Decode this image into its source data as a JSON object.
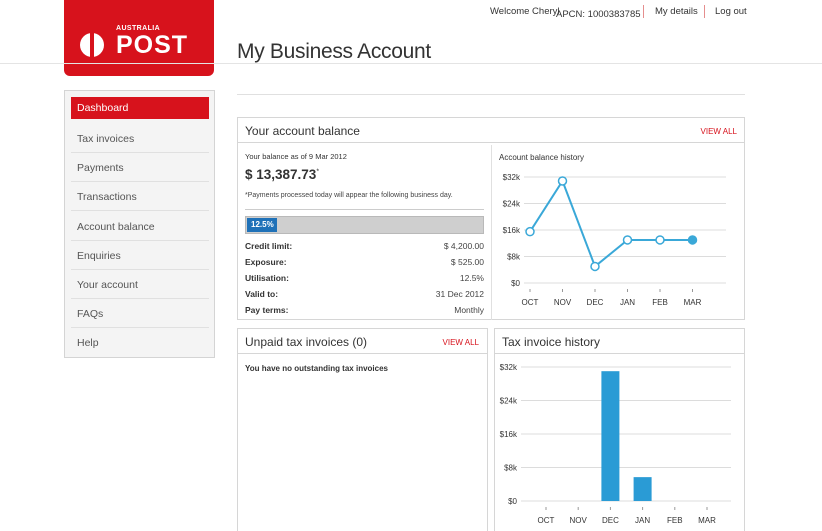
{
  "brand": {
    "country": "AUSTRALIA",
    "name": "POST",
    "color": "#d7121c"
  },
  "page_title": "My Business Account",
  "topnav": {
    "welcome": "Welcome Cheryl",
    "apcn": "APCN: 1000383785",
    "my_details": "My details",
    "log_out": "Log out"
  },
  "sidebar": {
    "items": [
      {
        "label": "Dashboard",
        "active": true
      },
      {
        "label": "Tax invoices"
      },
      {
        "label": "Payments"
      },
      {
        "label": "Transactions"
      },
      {
        "label": "Account balance"
      },
      {
        "label": "Enquiries"
      },
      {
        "label": "Your account"
      },
      {
        "label": "FAQs"
      },
      {
        "label": "Help"
      }
    ]
  },
  "balance": {
    "title": "Your account balance",
    "view_all": "VIEW ALL",
    "as_of": "Your balance as of 9 Mar 2012",
    "amount": "$ 13,387.73",
    "amount_mark": "*",
    "note": "*Payments processed today will appear the following business day.",
    "progress_label": "12.5%",
    "progress_value": 0.125,
    "rows": [
      {
        "label": "Credit limit:",
        "value": "$ 4,200.00"
      },
      {
        "label": "Exposure:",
        "value": "$ 525.00"
      },
      {
        "label": "Utilisation:",
        "value": "12.5%"
      },
      {
        "label": "Valid to:",
        "value": "31 Dec 2012"
      },
      {
        "label": "Pay terms:",
        "value": "Monthly"
      }
    ],
    "history_title": "Account balance history"
  },
  "unpaid": {
    "title": "Unpaid tax invoices (0)",
    "view_all": "VIEW ALL",
    "message": "You have no outstanding tax invoices"
  },
  "tax_history": {
    "title": "Tax invoice history"
  },
  "chart_data": [
    {
      "type": "line",
      "title": "Account balance history",
      "categories": [
        "OCT",
        "NOV",
        "DEC",
        "JAN",
        "FEB",
        "MAR"
      ],
      "values": [
        15500,
        30800,
        5000,
        13000,
        13000,
        13000
      ],
      "y_ticks": [
        "$0",
        "$8k",
        "$16k",
        "$24k",
        "$32k"
      ],
      "ylim": [
        0,
        32000
      ],
      "grid": true,
      "color": "#3aa8d8"
    },
    {
      "type": "bar",
      "title": "Tax invoice history",
      "categories": [
        "OCT",
        "NOV",
        "DEC",
        "JAN",
        "FEB",
        "MAR"
      ],
      "values": [
        0,
        0,
        31000,
        5700,
        0,
        0
      ],
      "y_ticks": [
        "$0",
        "$8k",
        "$16k",
        "$24k",
        "$32k"
      ],
      "ylim": [
        0,
        32000
      ],
      "grid": true,
      "color": "#2a9bd5"
    }
  ]
}
